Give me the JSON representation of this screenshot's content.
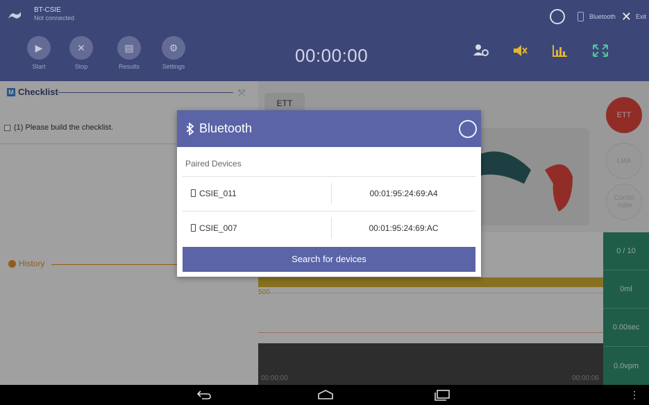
{
  "header": {
    "app_name": "BT-CSIE",
    "status": "Not connected",
    "bluetooth_label": "Bluetooth",
    "exit_label": "Exit",
    "timer": "00:00:00",
    "controls": [
      {
        "label": "Start",
        "icon": "play-icon"
      },
      {
        "label": "Stop",
        "icon": "close-icon"
      },
      {
        "label": "Results",
        "icon": "document-icon"
      },
      {
        "label": "Settings",
        "icon": "gear-icon"
      }
    ]
  },
  "checklist": {
    "title": "Checklist",
    "badge": "M",
    "item": "(1) Please build the checklist."
  },
  "history": {
    "title": "History"
  },
  "right": {
    "ett_tab": "ETT",
    "buttons": [
      "ETT",
      "LMA",
      "Combi\n-tube"
    ],
    "graph_value": "500",
    "time_start": "00:00:00",
    "time_end": "00:00:06",
    "stats": [
      "0 / 10",
      "0ml",
      "0.00sec",
      "0.0vpm"
    ]
  },
  "dialog": {
    "title": "Bluetooth",
    "section": "Paired Devices",
    "devices": [
      {
        "name": "CSIE_011",
        "address": "00:01:95:24:69:A4"
      },
      {
        "name": "CSIE_007",
        "address": "00:01:95:24:69:AC"
      }
    ],
    "search_label": "Search for devices"
  },
  "colors": {
    "header": "#3c4677",
    "dialog_accent": "#5a64a7",
    "ett_red": "#d8433a",
    "stats_green": "#2f8b6d"
  }
}
